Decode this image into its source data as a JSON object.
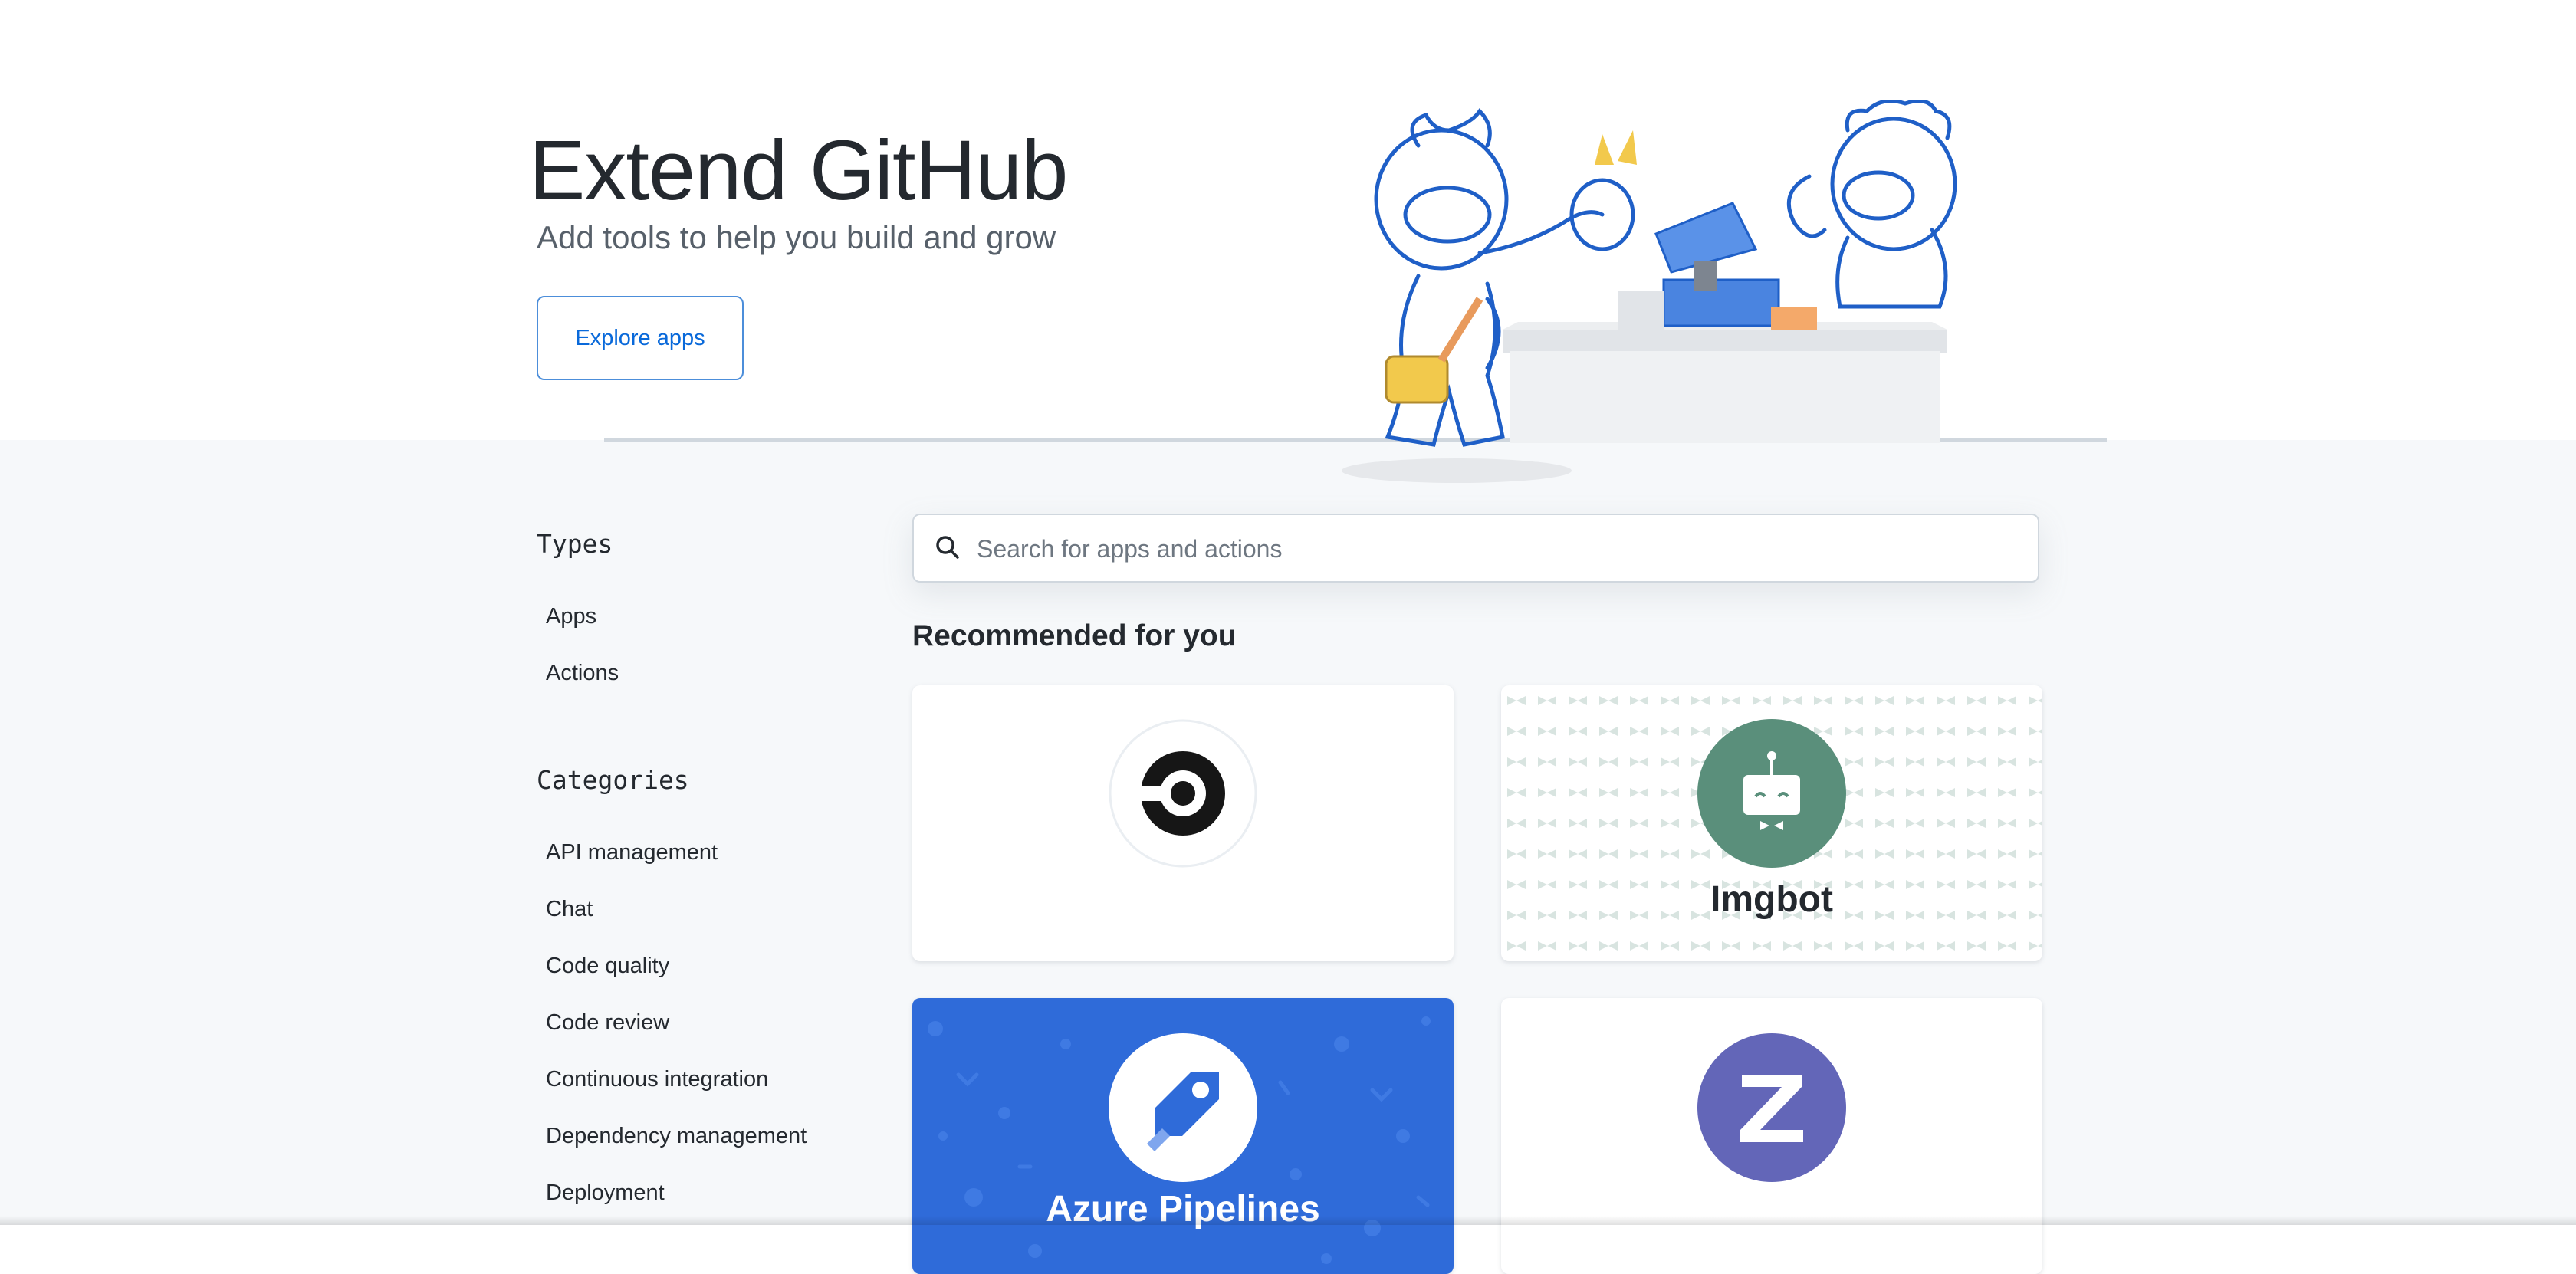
{
  "hero": {
    "title": "Extend GitHub",
    "subtitle": "Add tools to help you build and grow",
    "cta_label": "Explore apps"
  },
  "sidebar": {
    "types_heading": "Types",
    "types": [
      {
        "label": "Apps"
      },
      {
        "label": "Actions"
      }
    ],
    "categories_heading": "Categories",
    "categories": [
      {
        "label": "API management"
      },
      {
        "label": "Chat"
      },
      {
        "label": "Code quality"
      },
      {
        "label": "Code review"
      },
      {
        "label": "Continuous integration"
      },
      {
        "label": "Dependency management"
      },
      {
        "label": "Deployment"
      }
    ]
  },
  "search": {
    "placeholder": "Search for apps and actions",
    "icon": "search-icon"
  },
  "recommended": {
    "heading": "Recommended for you",
    "cards": [
      {
        "icon": "circleci-logo",
        "name": "",
        "background": "#ffffff"
      },
      {
        "icon": "imgbot-robot-logo",
        "name": "Imgbot",
        "background": "#ffffff",
        "accent": "#5a8f7b"
      },
      {
        "icon": "azure-pipelines-rocket-logo",
        "name": "Azure Pipelines",
        "background": "#2f6bd9"
      },
      {
        "icon": "zenhub-z-logo",
        "name": "",
        "background": "#ffffff",
        "accent": "#6366b8"
      }
    ]
  },
  "colors": {
    "link_blue": "#0969da",
    "lower_bg": "#f6f8fa",
    "azure_blue": "#2f6bd9",
    "imgbot_green": "#5a8f7b",
    "zenhub_purple": "#6366b8"
  }
}
